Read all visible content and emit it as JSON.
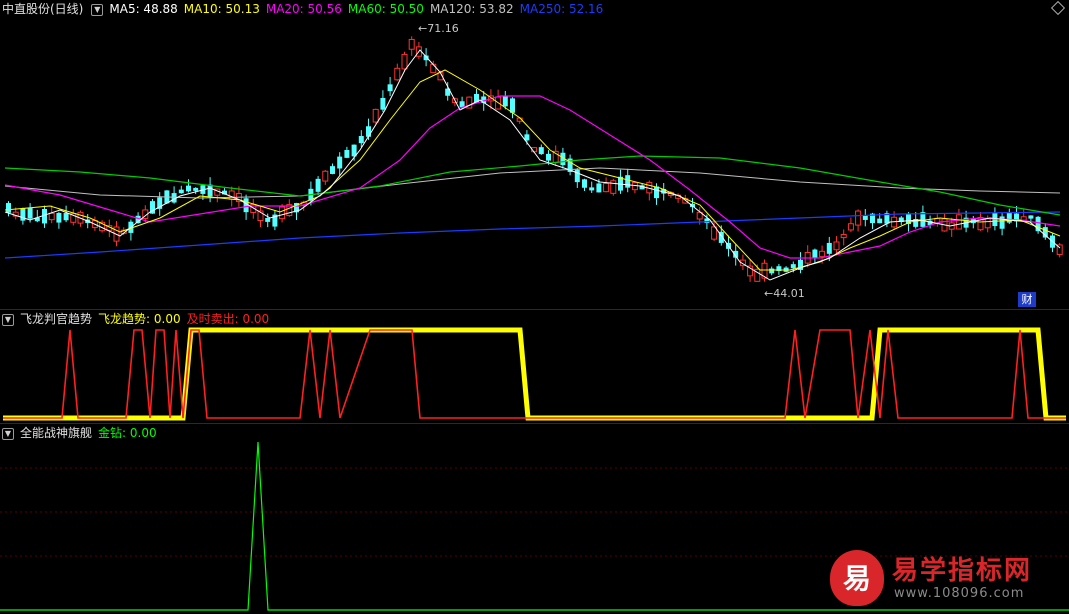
{
  "main": {
    "title": "中直股份(日线)",
    "ma": [
      {
        "label": "MA5: 48.88",
        "color": "#ffffff"
      },
      {
        "label": "MA10: 50.13",
        "color": "#ffff00"
      },
      {
        "label": "MA20: 50.56",
        "color": "#ff00ff"
      },
      {
        "label": "MA60: 50.50",
        "color": "#00ff00"
      },
      {
        "label": "MA120: 53.82",
        "color": "#c0c0c0"
      },
      {
        "label": "MA250: 52.16",
        "color": "#1a3cff"
      }
    ],
    "high_label": "71.16",
    "low_label": "44.01",
    "cai_label": "财"
  },
  "ind1": {
    "name": "飞龙判官趋势",
    "line1": "飞龙趋势: 0.00",
    "line1_color": "#ffff00",
    "line2": "及时卖出: 0.00",
    "line2_color": "#ff2020"
  },
  "ind2": {
    "name": "全能战神旗舰",
    "line1": "金钻: 0.00",
    "line1_color": "#00ff00"
  },
  "watermark": {
    "logo": "易",
    "title": "易学指标网",
    "url": "www.108096.com"
  }
}
